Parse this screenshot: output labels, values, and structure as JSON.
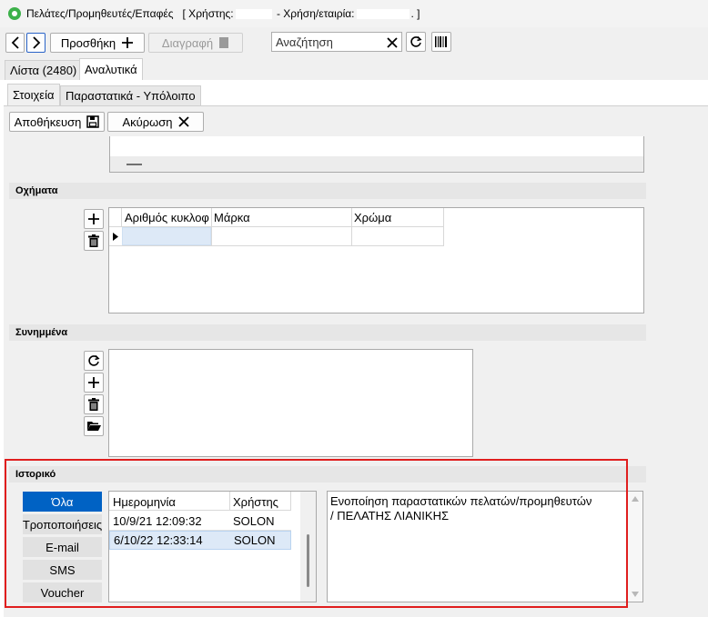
{
  "window": {
    "title": "Πελάτες/Προμηθευτές/Επαφές",
    "user_label": "[ Χρήστης:",
    "company_label": "- Χρήση/εταιρία:",
    "title_end": ". ]"
  },
  "toolbar": {
    "add_label": "Προσθήκη",
    "delete_label": "Διαγραφή",
    "search_placeholder": "Αναζήτηση"
  },
  "main_tabs": [
    {
      "label": "Λίστα (2480)"
    },
    {
      "label": "Αναλυτικά"
    }
  ],
  "sub_tabs": [
    {
      "label": "Στοιχεία"
    },
    {
      "label": "Παραστατικά - Υπόλοιπο"
    }
  ],
  "actions": {
    "save_label": "Αποθήκευση",
    "cancel_label": "Ακύρωση"
  },
  "vehicles": {
    "title": "Οχήματα",
    "columns": [
      "Αριθμός κυκλοφ",
      "Μάρκα",
      "Χρώμα"
    ]
  },
  "attachments": {
    "title": "Συνημμένα"
  },
  "history": {
    "title": "Ιστορικό",
    "filters": [
      "Όλα",
      "Τροποποιήσεις",
      "E-mail",
      "SMS",
      "Voucher"
    ],
    "columns": [
      "Ημερομηνία",
      "Χρήστης"
    ],
    "rows": [
      {
        "date": "10/9/21 12:09:32",
        "user": "SOLON"
      },
      {
        "date": "6/10/22 12:33:14",
        "user": "SOLON"
      }
    ],
    "detail_line1": "Ενοποίηση παραστατικών πελατών/προμηθευτών",
    "detail_line2": "/   ΠΕΛΑΤΗΣ ΛΙΑΝΙΚΗΣ"
  }
}
